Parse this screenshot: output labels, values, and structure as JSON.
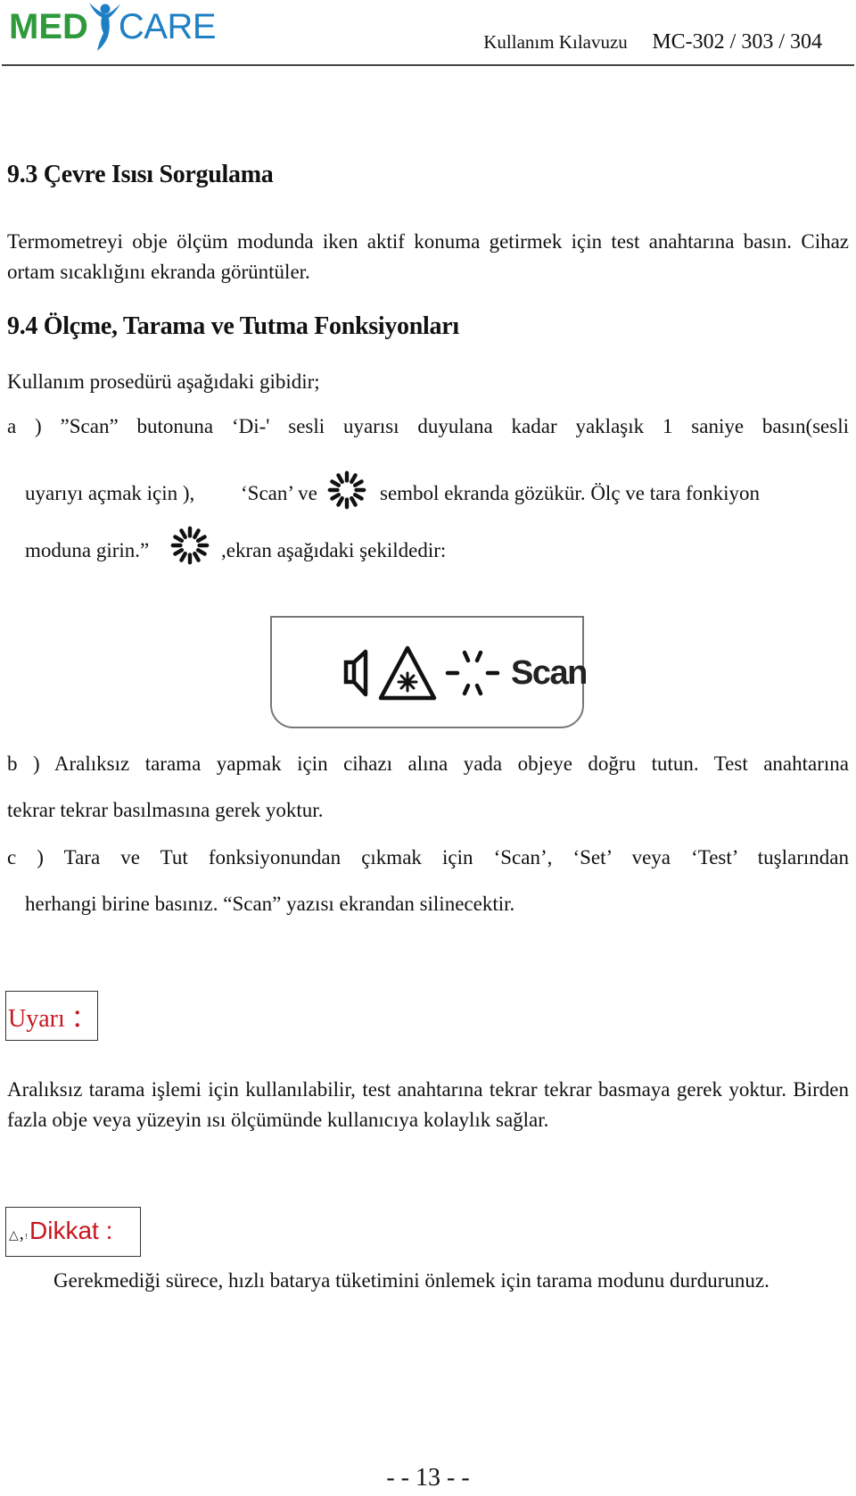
{
  "header": {
    "logo_left": "MED",
    "logo_right": "CARE",
    "manual_title": "Kullanım Kılavuzu",
    "model": "MC-302 / 303 / 304",
    "colors": {
      "logo_green": "#2e9a3c",
      "logo_blue": "#1f7fc4"
    }
  },
  "section_9_3": {
    "heading": "9.3 Çevre Isısı Sorgulama",
    "body": "Termometreyi obje ölçüm modunda iken aktif konuma getirmek için test anahtarına basın. Cihaz ortam sıcaklığını ekranda görüntüler."
  },
  "section_9_4": {
    "heading": "9.4 Ölçme, Tarama ve Tutma Fonksiyonları",
    "intro": "Kullanım prosedürü aşağıdaki gibidir;",
    "step_a": {
      "line1": "a ) ”Scan” butonuna ‘Di-' sesli uyarısı duyulana kadar yaklaşık 1 saniye basın(sesli",
      "line2_part1": "uyarıyı açmak için ),",
      "line2_part2": "‘Scan’ ve",
      "line2_part3": "sembol ekranda gözükür. Ölç ve tara fonkiyon",
      "line3_part1": "moduna girin.”",
      "line3_part2": ",ekran aşağıdaki şekildedir:"
    },
    "lcd_display": {
      "icons": [
        "speaker-icon",
        "laser-warning-icon",
        "scan-rays-icon"
      ],
      "label": "Scan"
    },
    "step_b": {
      "line1": "b ) Aralıksız tarama yapmak için cihazı alına yada objeye doğru tutun. Test anahtarına",
      "line2": "tekrar tekrar basılmasına gerek yoktur."
    },
    "step_c": {
      "line1": "c ) Tara ve Tut fonksiyonundan çıkmak için ‘Scan’, ‘Set’ veya ‘Test’ tuşlarından",
      "line2": "herhangi birine basınız. “Scan” yazısı ekrandan silinecektir."
    }
  },
  "warning": {
    "label": "Uyarı ：",
    "body": "Aralıksız tarama işlemi için kullanılabilir, test anahtarına tekrar tekrar basmaya gerek yoktur. Birden fazla obje veya yüzeyin ısı ölçümünde kullanıcıya kolaylık sağlar.",
    "color": "#c8161d"
  },
  "caution": {
    "triangle": "△",
    "comma": ",",
    "excl": "!",
    "label": "Dikkat :",
    "body": "Gerekmediği sürece, hızlı batarya tüketimini önlemek için tarama modunu durdurunuz.",
    "color": "#c8161d"
  },
  "footer": {
    "page_number": "- - 13 - -"
  }
}
